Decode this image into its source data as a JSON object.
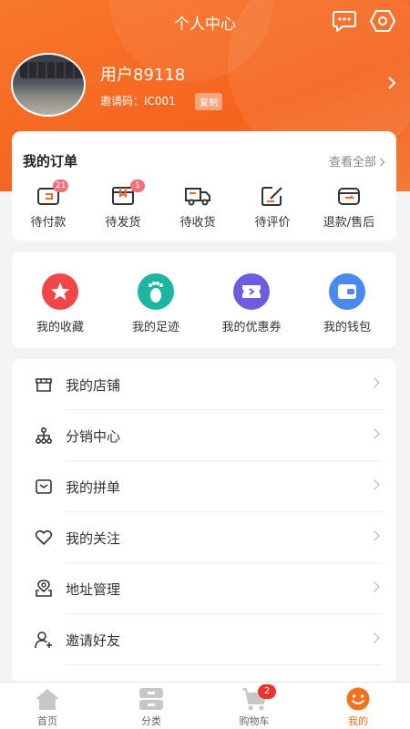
{
  "header": {
    "title": "个人中心"
  },
  "user": {
    "name": "用户89118",
    "invite_label": "邀请码：IC001",
    "copy_label": "复制"
  },
  "orders": {
    "title": "我的订单",
    "view_all": "查看全部",
    "items": [
      {
        "label": "待付款",
        "badge": "21",
        "icon": "wallet-icon"
      },
      {
        "label": "待发货",
        "badge": "1",
        "icon": "package-icon"
      },
      {
        "label": "待收货",
        "badge": "",
        "icon": "truck-icon"
      },
      {
        "label": "待评价",
        "badge": "",
        "icon": "edit-icon"
      },
      {
        "label": "退款/售后",
        "badge": "",
        "icon": "refund-wallet-icon"
      }
    ]
  },
  "quick": {
    "items": [
      {
        "label": "我的收藏",
        "icon": "star-icon",
        "color": "#ef4747"
      },
      {
        "label": "我的足迹",
        "icon": "footprint-icon",
        "color": "#1cb6a0"
      },
      {
        "label": "我的优惠券",
        "icon": "coupon-icon",
        "color": "#6c5de0"
      },
      {
        "label": "我的钱包",
        "icon": "wallet-icon",
        "color": "#4a8af0"
      }
    ]
  },
  "menu": {
    "items": [
      {
        "label": "我的店铺",
        "icon": "store-icon"
      },
      {
        "label": "分销中心",
        "icon": "network-icon"
      },
      {
        "label": "我的拼单",
        "icon": "mail-icon"
      },
      {
        "label": "我的关注",
        "icon": "heart-icon"
      },
      {
        "label": "地址管理",
        "icon": "location-icon"
      },
      {
        "label": "邀请好友",
        "icon": "add-user-icon"
      }
    ]
  },
  "tabbar": {
    "items": [
      {
        "label": "首页",
        "icon": "home-icon"
      },
      {
        "label": "分类",
        "icon": "category-icon"
      },
      {
        "label": "购物车",
        "icon": "cart-icon",
        "badge": "2"
      },
      {
        "label": "我的",
        "icon": "smile-icon",
        "active": true
      }
    ]
  },
  "colors": {
    "brand": "#f5641f",
    "badge": "#f3707a",
    "cart_badge": "#e8352a"
  }
}
